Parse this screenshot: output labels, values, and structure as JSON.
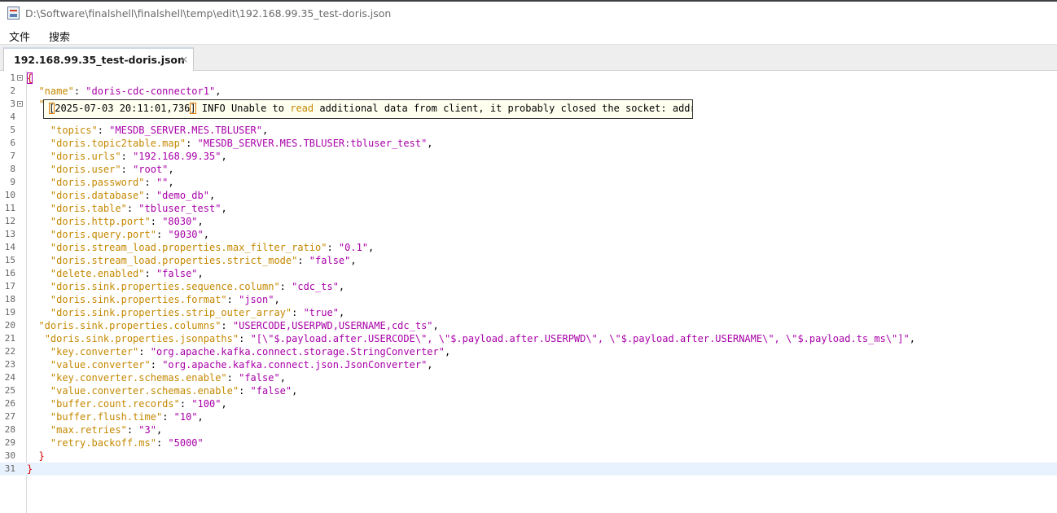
{
  "window": {
    "title": "D:\\Software\\finalshell\\finalshell\\temp\\edit\\192.168.99.35_test-doris.json",
    "icon": "java-app-icon"
  },
  "menu": [
    "文件",
    "搜索"
  ],
  "tab": {
    "label": "192.168.99.35_test-doris.json",
    "close": "×"
  },
  "tooltip": {
    "timestamp_open": "[",
    "timestamp": "2025-07-03 20:11:01,736",
    "timestamp_close": "]",
    "before": " INFO Unable to ",
    "keyword": "read",
    "after": " additional data from client, it probably closed the socket: addres"
  },
  "lines": [
    {
      "n": "1",
      "fold": true,
      "indent": "",
      "brace": "{"
    },
    {
      "n": "2",
      "indent": "  ",
      "key": "\"name\"",
      "value": "\"doris-cdc-connector1\"",
      "tail": ","
    },
    {
      "n": "3",
      "fold": true,
      "indent": "  ",
      "key": "\"",
      "value": "",
      "tail": ""
    },
    {
      "n": "4",
      "indent": "    ",
      "key": "",
      "value": "",
      "tail": ""
    },
    {
      "n": "5",
      "indent": "    ",
      "key": "\"topics\"",
      "value": "\"MESDB_SERVER.MES.TBLUSER\"",
      "tail": ","
    },
    {
      "n": "6",
      "indent": "    ",
      "key": "\"doris.topic2table.map\"",
      "value": "\"MESDB_SERVER.MES.TBLUSER:tbluser_test\"",
      "tail": ","
    },
    {
      "n": "7",
      "indent": "    ",
      "key": "\"doris.urls\"",
      "value": "\"192.168.99.35\"",
      "tail": ","
    },
    {
      "n": "8",
      "indent": "    ",
      "key": "\"doris.user\"",
      "value": "\"root\"",
      "tail": ","
    },
    {
      "n": "9",
      "indent": "    ",
      "key": "\"doris.password\"",
      "value": "\"\"",
      "tail": ","
    },
    {
      "n": "10",
      "indent": "    ",
      "key": "\"doris.database\"",
      "value": "\"demo_db\"",
      "tail": ","
    },
    {
      "n": "11",
      "indent": "    ",
      "key": "\"doris.table\"",
      "value": "\"tbluser_test\"",
      "tail": ","
    },
    {
      "n": "12",
      "indent": "    ",
      "key": "\"doris.http.port\"",
      "value": "\"8030\"",
      "tail": ","
    },
    {
      "n": "13",
      "indent": "    ",
      "key": "\"doris.query.port\"",
      "value": "\"9030\"",
      "tail": ","
    },
    {
      "n": "14",
      "indent": "    ",
      "key": "\"doris.stream_load.properties.max_filter_ratio\"",
      "value": "\"0.1\"",
      "tail": ","
    },
    {
      "n": "15",
      "indent": "    ",
      "key": "\"doris.stream_load.properties.strict_mode\"",
      "value": "\"false\"",
      "tail": ","
    },
    {
      "n": "16",
      "indent": "    ",
      "key": "\"delete.enabled\"",
      "value": "\"false\"",
      "tail": ","
    },
    {
      "n": "17",
      "indent": "    ",
      "key": "\"doris.sink.properties.sequence.column\"",
      "value": "\"cdc_ts\"",
      "tail": ","
    },
    {
      "n": "18",
      "indent": "    ",
      "key": "\"doris.sink.properties.format\"",
      "value": "\"json\"",
      "tail": ","
    },
    {
      "n": "19",
      "indent": "    ",
      "key": "\"doris.sink.properties.strip_outer_array\"",
      "value": "\"true\"",
      "tail": ","
    },
    {
      "n": "20",
      "indent": "  ",
      "key": "\"doris.sink.properties.columns\"",
      "value": "\"USERCODE,USERPWD,USERNAME,cdc_ts\"",
      "tail": ","
    },
    {
      "n": "21",
      "indent": "   ",
      "key": "\"doris.sink.properties.jsonpaths\"",
      "value": "\"[\\\"$.payload.after.USERCODE\\\", \\\"$.payload.after.USERPWD\\\", \\\"$.payload.after.USERNAME\\\", \\\"$.payload.ts_ms\\\"]\"",
      "tail": ","
    },
    {
      "n": "22",
      "indent": "    ",
      "key": "\"key.converter\"",
      "value": "\"org.apache.kafka.connect.storage.StringConverter\"",
      "tail": ","
    },
    {
      "n": "23",
      "indent": "    ",
      "key": "\"value.converter\"",
      "value": "\"org.apache.kafka.connect.json.JsonConverter\"",
      "tail": ","
    },
    {
      "n": "24",
      "indent": "    ",
      "key": "\"key.converter.schemas.enable\"",
      "value": "\"false\"",
      "tail": ","
    },
    {
      "n": "25",
      "indent": "    ",
      "key": "\"value.converter.schemas.enable\"",
      "value": "\"false\"",
      "tail": ","
    },
    {
      "n": "26",
      "indent": "    ",
      "key": "\"buffer.count.records\"",
      "value": "\"100\"",
      "tail": ","
    },
    {
      "n": "27",
      "indent": "    ",
      "key": "\"buffer.flush.time\"",
      "value": "\"10\"",
      "tail": ","
    },
    {
      "n": "28",
      "indent": "    ",
      "key": "\"max.retries\"",
      "value": "\"3\"",
      "tail": ","
    },
    {
      "n": "29",
      "indent": "    ",
      "key": "\"retry.backoff.ms\"",
      "value": "\"5000\"",
      "tail": ""
    },
    {
      "n": "30",
      "indent": "  ",
      "brace": "}"
    },
    {
      "n": "31",
      "indent": "",
      "brace": "}",
      "current": true
    }
  ],
  "colors": {
    "key": "#c48800",
    "value": "#a800a8",
    "brace": "#d40000",
    "current_line": "#e8f2fe"
  }
}
